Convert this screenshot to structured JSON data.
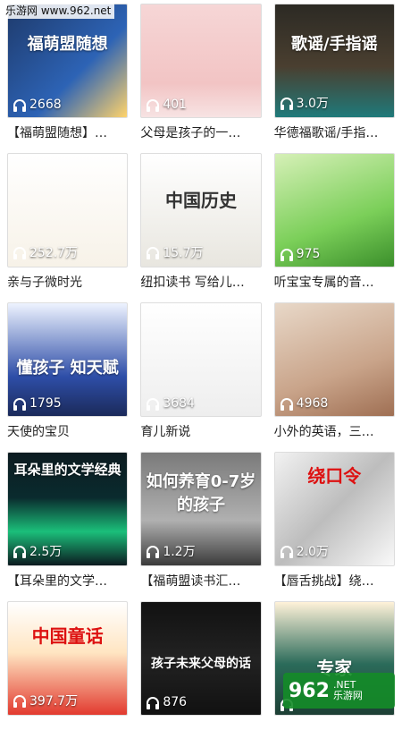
{
  "watermarks": {
    "top": "乐游网 www.962.net",
    "bottom_num": "962",
    "bottom_line1": ".NET",
    "bottom_line2": "乐游网"
  },
  "items": [
    {
      "title": "【福萌盟随想】…",
      "plays": "2668",
      "cover_text": "福萌盟随想"
    },
    {
      "title": "父母是孩子的一…",
      "plays": "401",
      "cover_text": ""
    },
    {
      "title": "华德福歌谣/手指…",
      "plays": "3.0万",
      "cover_text": "歌谣/手指谣"
    },
    {
      "title": "亲与子微时光",
      "plays": "252.7万",
      "cover_text": ""
    },
    {
      "title": "纽扣读书 写给儿…",
      "plays": "15.7万",
      "cover_text": "中国历史"
    },
    {
      "title": "听宝宝专属的音…",
      "plays": "975",
      "cover_text": ""
    },
    {
      "title": "天使的宝贝",
      "plays": "1795",
      "cover_text": "懂孩子 知天赋"
    },
    {
      "title": "育儿新说",
      "plays": "3684",
      "cover_text": ""
    },
    {
      "title": "小外的英语，三…",
      "plays": "4968",
      "cover_text": ""
    },
    {
      "title": "【耳朵里的文学…",
      "plays": "2.5万",
      "cover_text": "耳朵里的文学经典"
    },
    {
      "title": "【福萌盟读书汇…",
      "plays": "1.2万",
      "cover_text": "如何养育0-7岁的孩子"
    },
    {
      "title": "【唇舌挑战】绕…",
      "plays": "2.0万",
      "cover_text": "绕口令"
    },
    {
      "title": "",
      "plays": "397.7万",
      "cover_text": "中国童话"
    },
    {
      "title": "",
      "plays": "876",
      "cover_text": "孩子未来父母的话"
    },
    {
      "title": "",
      "plays": "",
      "cover_text": "专家"
    }
  ]
}
